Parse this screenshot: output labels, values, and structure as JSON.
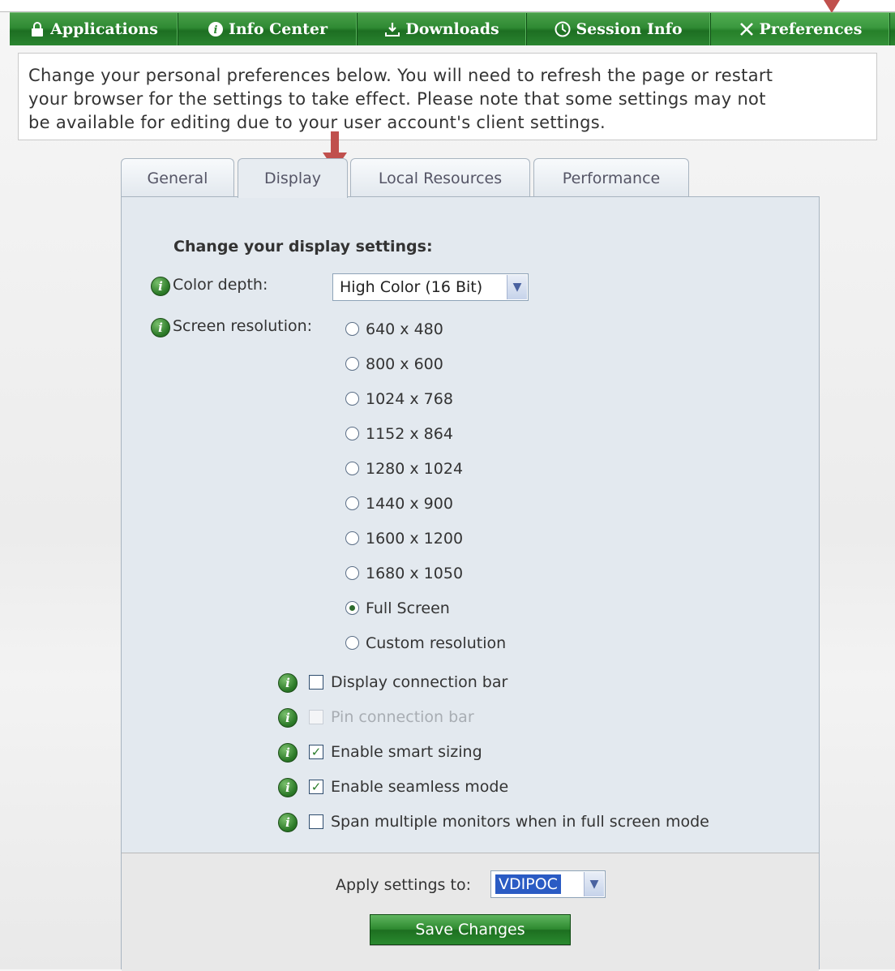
{
  "nav": {
    "items": [
      {
        "label": "Applications",
        "icon": "lock-icon",
        "active": false
      },
      {
        "label": "Info Center",
        "icon": "info-icon",
        "active": false
      },
      {
        "label": "Downloads",
        "icon": "download-icon",
        "active": false
      },
      {
        "label": "Session Info",
        "icon": "session-icon",
        "active": false
      },
      {
        "label": "Preferences",
        "icon": "tools-icon",
        "active": true
      }
    ]
  },
  "intro": {
    "line1": "Change your personal preferences below. You will need to refresh the page or restart",
    "line2": "your browser for the settings to take effect. Please note that some settings may not",
    "line3": "be available for editing due to your user account's client settings."
  },
  "tabs": [
    {
      "label": "General",
      "active": false
    },
    {
      "label": "Display",
      "active": true
    },
    {
      "label": "Local Resources",
      "active": false
    },
    {
      "label": "Performance",
      "active": false
    }
  ],
  "display": {
    "heading": "Change your display settings:",
    "color_depth_label": "Color depth:",
    "color_depth_value": "High Color (16 Bit)",
    "resolution_label": "Screen resolution:",
    "resolutions": [
      {
        "label": "640 x 480",
        "checked": false
      },
      {
        "label": "800 x 600",
        "checked": false
      },
      {
        "label": "1024 x 768",
        "checked": false
      },
      {
        "label": "1152 x 864",
        "checked": false
      },
      {
        "label": "1280 x 1024",
        "checked": false
      },
      {
        "label": "1440 x 900",
        "checked": false
      },
      {
        "label": "1600 x 1200",
        "checked": false
      },
      {
        "label": "1680 x 1050",
        "checked": false
      },
      {
        "label": "Full Screen",
        "checked": true
      },
      {
        "label": "Custom resolution",
        "checked": false
      }
    ],
    "options": [
      {
        "label": "Display connection bar",
        "checked": false,
        "disabled": false
      },
      {
        "label": "Pin connection bar",
        "checked": false,
        "disabled": true
      },
      {
        "label": "Enable smart sizing",
        "checked": true,
        "disabled": false
      },
      {
        "label": "Enable seamless mode",
        "checked": true,
        "disabled": false
      },
      {
        "label": "Span multiple monitors when in full screen mode",
        "checked": false,
        "disabled": false
      }
    ]
  },
  "footer": {
    "apply_label": "Apply settings to:",
    "apply_value": "VDIPOC",
    "save_label": "Save Changes"
  },
  "colors": {
    "nav_green": "#2f8a33",
    "accent_arrow": "#c0504d",
    "panel_bg": "#e3e9ef"
  }
}
